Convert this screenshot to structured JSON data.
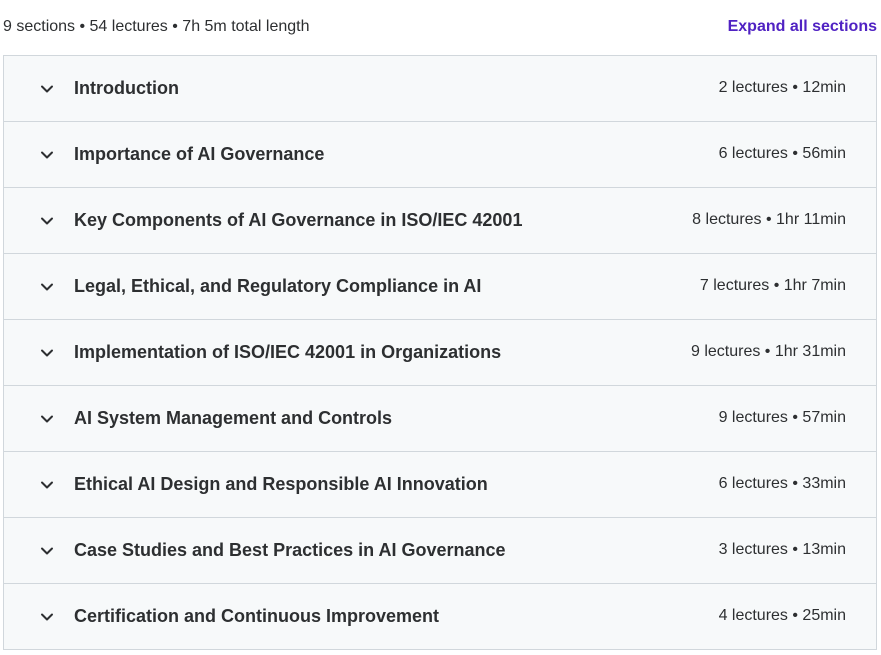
{
  "header": {
    "summary": "9 sections • 54 lectures • 7h 5m total length",
    "expand_label": "Expand all sections"
  },
  "sections": [
    {
      "title": "Introduction",
      "meta": "2 lectures • 12min"
    },
    {
      "title": "Importance of AI Governance",
      "meta": "6 lectures • 56min"
    },
    {
      "title": "Key Components of AI Governance in ISO/IEC 42001",
      "meta": "8 lectures • 1hr 11min"
    },
    {
      "title": "Legal, Ethical, and Regulatory Compliance in AI",
      "meta": "7 lectures • 1hr 7min"
    },
    {
      "title": "Implementation of ISO/IEC 42001 in Organizations",
      "meta": "9 lectures • 1hr 31min"
    },
    {
      "title": "AI System Management and Controls",
      "meta": "9 lectures • 57min"
    },
    {
      "title": "Ethical AI Design and Responsible AI Innovation",
      "meta": "6 lectures • 33min"
    },
    {
      "title": "Case Studies and Best Practices in AI Governance",
      "meta": "3 lectures • 13min"
    },
    {
      "title": "Certification and Continuous Improvement",
      "meta": "4 lectures • 25min"
    }
  ],
  "icons": {
    "chevron": "chevron-down-icon"
  },
  "colors": {
    "accent": "#5022c3",
    "text": "#2d2f31",
    "section_bg": "#f7f9fa",
    "border": "#d1d7dc"
  }
}
